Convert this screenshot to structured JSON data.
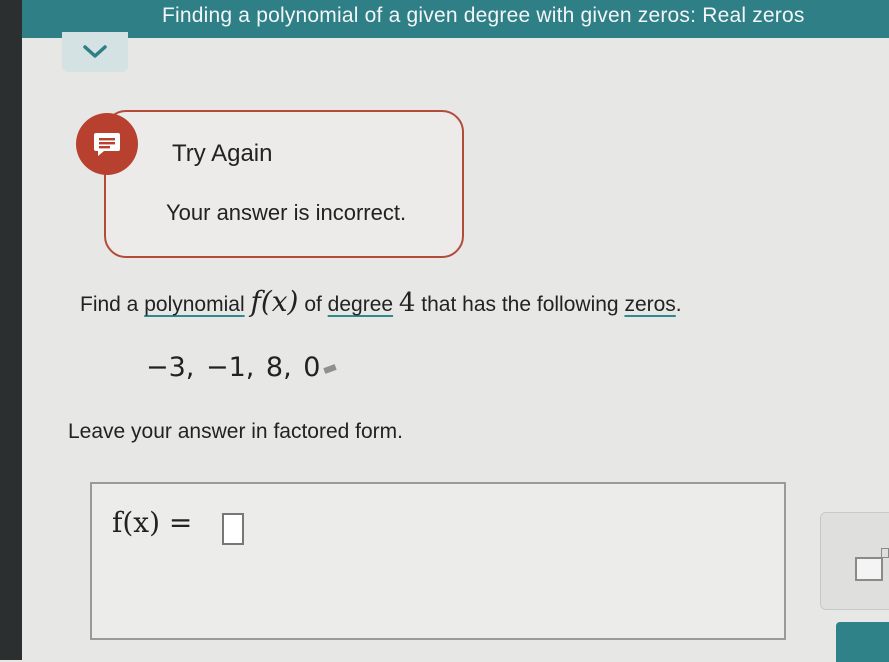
{
  "header": {
    "title": "Finding a polynomial of a given degree with given zeros: Real zeros"
  },
  "feedback": {
    "title": "Try Again",
    "message": "Your answer is incorrect."
  },
  "question": {
    "prefix": "Find a",
    "term_polynomial": "polynomial",
    "fx": "f(x)",
    "of": "of",
    "term_degree": "degree",
    "degree_value": "4",
    "middle": "that has the following",
    "term_zeros": "zeros",
    "period": ".",
    "zeros": "−3, −1, 8, 0",
    "instruction": "Leave your answer in factored form."
  },
  "answer": {
    "label": "f(x) ="
  }
}
